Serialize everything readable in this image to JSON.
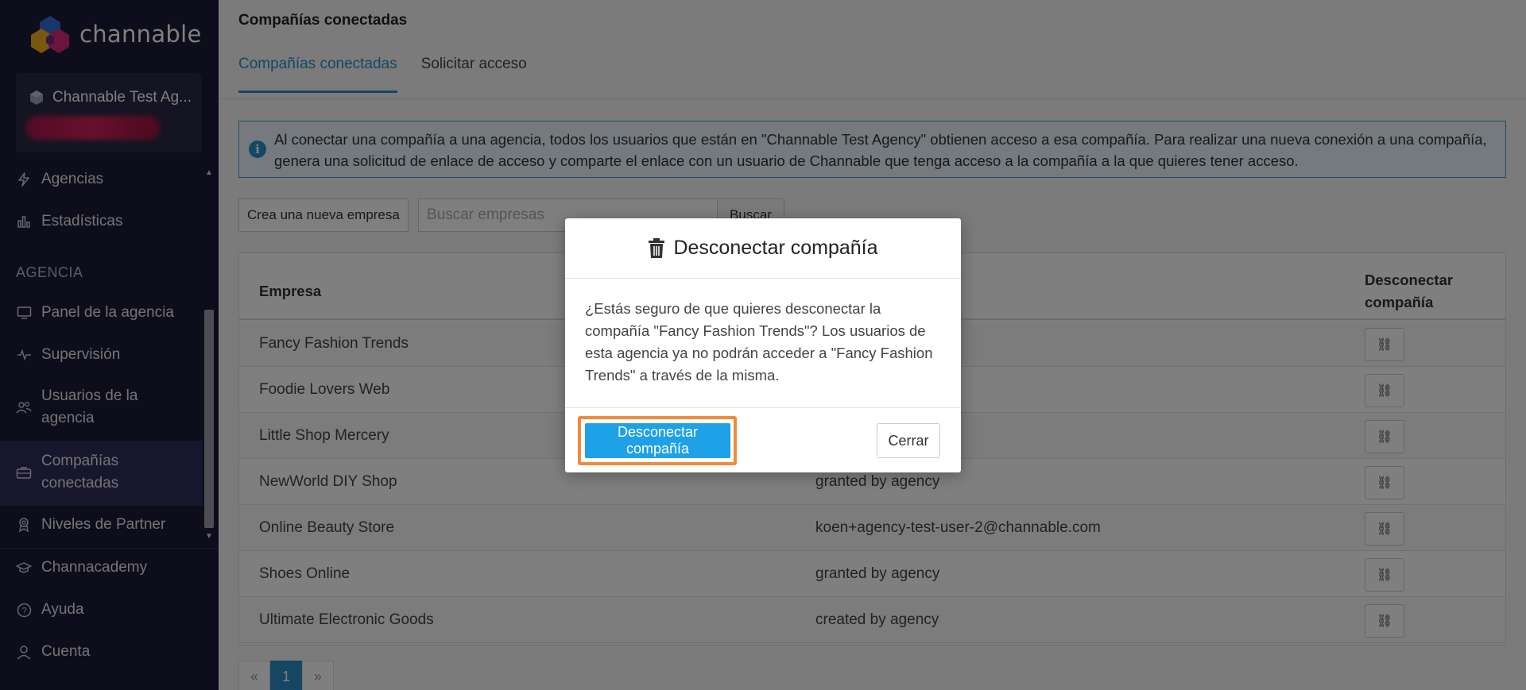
{
  "brand": {
    "name": "channable"
  },
  "sidebar": {
    "agency_name": "Channable Test Ag...",
    "section_label": "AGENCIA",
    "items": [
      {
        "label": "Agencias",
        "icon": "bolt-icon"
      },
      {
        "label": "Estadísticas",
        "icon": "bar-chart-icon"
      },
      {
        "label": "Panel de la agencia",
        "icon": "monitor-icon"
      },
      {
        "label": "Supervisión",
        "icon": "pulse-icon"
      },
      {
        "label": "Usuarios de la agencia",
        "icon": "users-icon"
      },
      {
        "label": "Compañías conectadas",
        "icon": "briefcase-icon"
      },
      {
        "label": "Niveles de Partner",
        "icon": "badge-icon"
      },
      {
        "label": "Channacademy",
        "icon": "graduation-cap-icon"
      },
      {
        "label": "Ayuda",
        "icon": "help-circle-icon"
      },
      {
        "label": "Cuenta",
        "icon": "user-icon"
      }
    ]
  },
  "main": {
    "title": "Compañías conectadas",
    "tabs": [
      {
        "label": "Compañías conectadas",
        "active": true
      },
      {
        "label": "Solicitar acceso",
        "active": false
      }
    ],
    "info_text": "Al conectar una compañía a una agencia, todos los usuarios que están en \"Channable Test Agency\" obtienen acceso a esa compañía. Para realizar una nueva conexión a una compañía, genera una solicitud de enlace de acceso y comparte el enlace con un usuario de Channable que tenga acceso a la compañía a la que quieres tener acceso.",
    "new_company_label": "Crea una nueva empresa",
    "search_placeholder": "Buscar empresas",
    "search_button": "Buscar",
    "table": {
      "col_company": "Empresa",
      "col_disconnect": "Desconectar compañía",
      "rows": [
        {
          "company": "Fancy Fashion Trends",
          "access": ""
        },
        {
          "company": "Foodie Lovers Web",
          "access": ""
        },
        {
          "company": "Little Shop Mercery",
          "access": ""
        },
        {
          "company": "NewWorld DIY Shop",
          "access": "granted by agency"
        },
        {
          "company": "Online Beauty Store",
          "access": "koen+agency-test-user-2@channable.com"
        },
        {
          "company": "Shoes Online",
          "access": "granted by agency"
        },
        {
          "company": "Ultimate Electronic Goods",
          "access": "created by agency"
        }
      ]
    },
    "pagination": {
      "prev": "«",
      "current": "1",
      "next": "»"
    }
  },
  "modal": {
    "title": "Desconectar compañía",
    "icon": "trash-icon",
    "body": "¿Estás seguro de que quieres desconectar la compañía \"Fancy Fashion Trends\"? Los usuarios de esta agencia ya no podrán acceder a \"Fancy Fashion Trends\" a través de la misma.",
    "confirm_label": "Desconectar compañía",
    "close_label": "Cerrar"
  },
  "colors": {
    "sidebar_bg": "#1c1b36",
    "accent": "#2a8fc9",
    "primary_button": "#1ea1e6",
    "highlight": "#f28a3c"
  }
}
